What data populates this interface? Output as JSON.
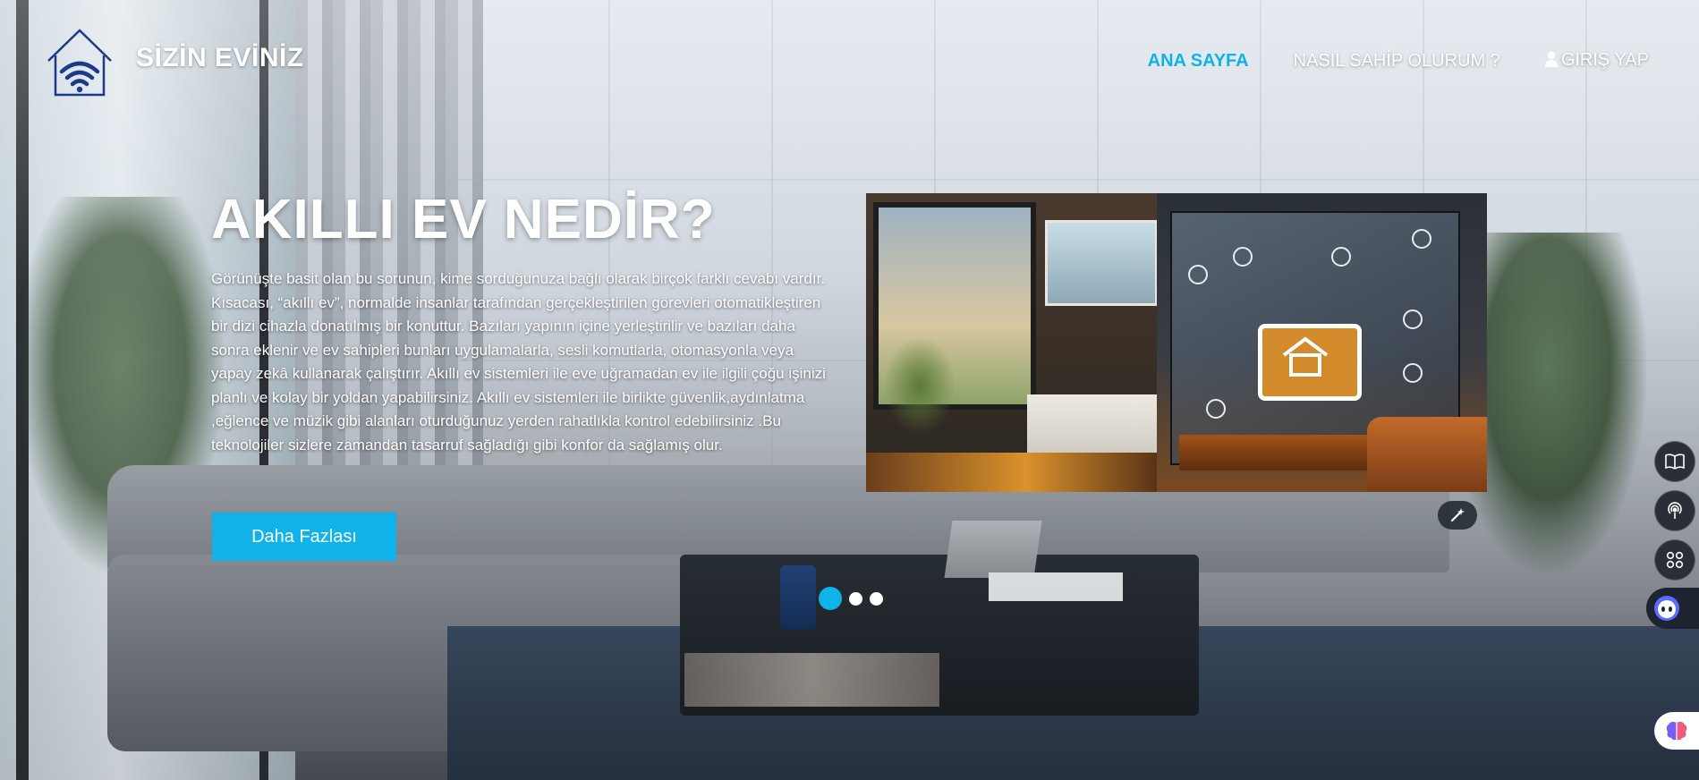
{
  "brand": {
    "name": "SİZİN EVİNİZ",
    "logo_icon": "wifi-house-icon",
    "logo_color": "#1c3a8a"
  },
  "nav": {
    "items": [
      {
        "label": "ANA SAYFA",
        "active": true
      },
      {
        "label": "NASIL SAHİP OLURUM ?",
        "active": false
      },
      {
        "label": "GIRIŞ YAP",
        "active": false,
        "icon": "user-icon"
      }
    ]
  },
  "hero": {
    "title": "AKILLI EV NEDİR?",
    "description": "Görünüşte basit olan bu sorunun, kime sorduğunuza bağlı olarak birçok farklı cevabı vardır. Kısacası, “akıllı ev”, normalde insanlar tarafından gerçekleştirilen görevleri otomatikleştiren bir dizi cihazla donatılmış bir konuttur. Bazıları yapının içine yerleştirilir ve bazıları daha sonra eklenir ve ev sahipleri bunları uygulamalarla, sesli komutlarla, otomasyonla veya yapay zekâ kullanarak çalıştırır. Akıllı ev sistemleri ile eve uğramadan ev ile ilgili çoğu işinizi planlı ve kolay bir yoldan yapabilirsiniz. Akıllı ev sistemleri ile birlikte güvenlik,aydınlatma ,eğlence ve müzik gibi alanları oturduğunuz yerden rahatlıkla kontrol edebilirsiniz .Bu teknolojiler sizlere zamandan tasarruf sağladığı gibi konfor da sağlamış olur.",
    "cta_label": "Daha Fazlası",
    "image_icon": "smart-home-illustration",
    "magic_icon": "magic-wand-icon"
  },
  "carousel": {
    "slide_count": 3,
    "active_index": 0
  },
  "side_tools": [
    {
      "icon": "book-icon"
    },
    {
      "icon": "broadcast-icon"
    },
    {
      "icon": "grid-command-icon"
    },
    {
      "icon": "assistant-face-icon"
    },
    {
      "icon": "brain-icon"
    }
  ],
  "colors": {
    "accent": "#0fb3ea",
    "text": "#ffffff"
  }
}
